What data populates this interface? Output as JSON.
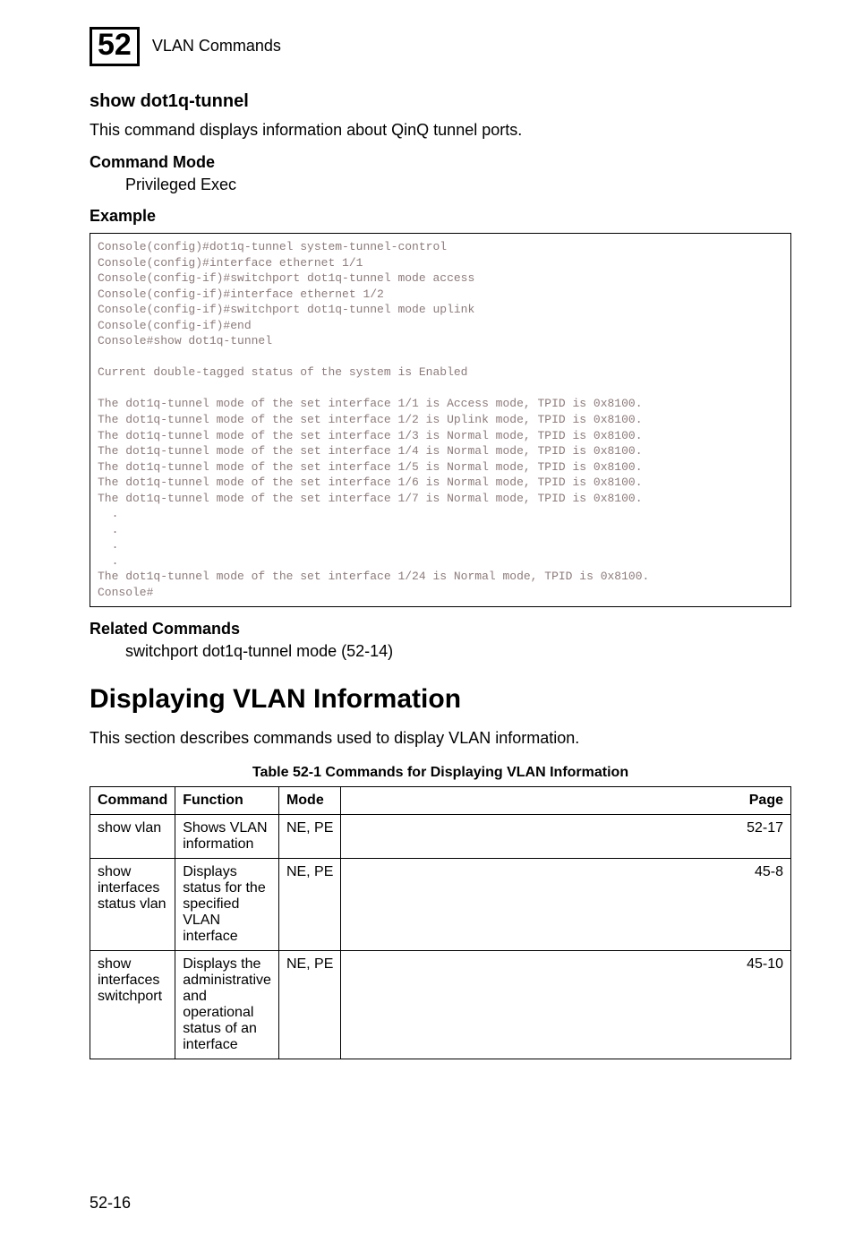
{
  "header": {
    "chapter_number": "52",
    "chapter_title": "VLAN Commands"
  },
  "section": {
    "title": "show dot1q-tunnel",
    "description": "This command displays information about QinQ tunnel ports."
  },
  "command_mode": {
    "heading": "Command Mode",
    "value": "Privileged Exec"
  },
  "example": {
    "heading": "Example",
    "code": "Console(config)#dot1q-tunnel system-tunnel-control\nConsole(config)#interface ethernet 1/1\nConsole(config-if)#switchport dot1q-tunnel mode access\nConsole(config-if)#interface ethernet 1/2\nConsole(config-if)#switchport dot1q-tunnel mode uplink\nConsole(config-if)#end\nConsole#show dot1q-tunnel\n\nCurrent double-tagged status of the system is Enabled\n\nThe dot1q-tunnel mode of the set interface 1/1 is Access mode, TPID is 0x8100.\nThe dot1q-tunnel mode of the set interface 1/2 is Uplink mode, TPID is 0x8100.\nThe dot1q-tunnel mode of the set interface 1/3 is Normal mode, TPID is 0x8100.\nThe dot1q-tunnel mode of the set interface 1/4 is Normal mode, TPID is 0x8100.\nThe dot1q-tunnel mode of the set interface 1/5 is Normal mode, TPID is 0x8100.\nThe dot1q-tunnel mode of the set interface 1/6 is Normal mode, TPID is 0x8100.\nThe dot1q-tunnel mode of the set interface 1/7 is Normal mode, TPID is 0x8100.\n  .\n  .\n  .\n  .\nThe dot1q-tunnel mode of the set interface 1/24 is Normal mode, TPID is 0x8100.\nConsole#"
  },
  "related_commands": {
    "heading": "Related Commands",
    "value": "switchport dot1q-tunnel mode (52-14)"
  },
  "displaying_vlan": {
    "heading": "Displaying VLAN Information",
    "description": "This section describes commands used to display VLAN information."
  },
  "table": {
    "caption": "Table 52-1   Commands for Displaying VLAN Information",
    "headers": {
      "command": "Command",
      "function": "Function",
      "mode": "Mode",
      "page": "Page"
    },
    "rows": [
      {
        "command": "show vlan",
        "function": "Shows VLAN information",
        "mode": "NE, PE",
        "page": "52-17"
      },
      {
        "command": "show interfaces status vlan",
        "function": "Displays status for the specified VLAN interface",
        "mode": "NE, PE",
        "page": "45-8"
      },
      {
        "command": "show interfaces switchport",
        "function": "Displays the administrative and operational status of an interface",
        "mode": "NE, PE",
        "page": "45-10"
      }
    ]
  },
  "footer": {
    "page_number": "52-16"
  }
}
